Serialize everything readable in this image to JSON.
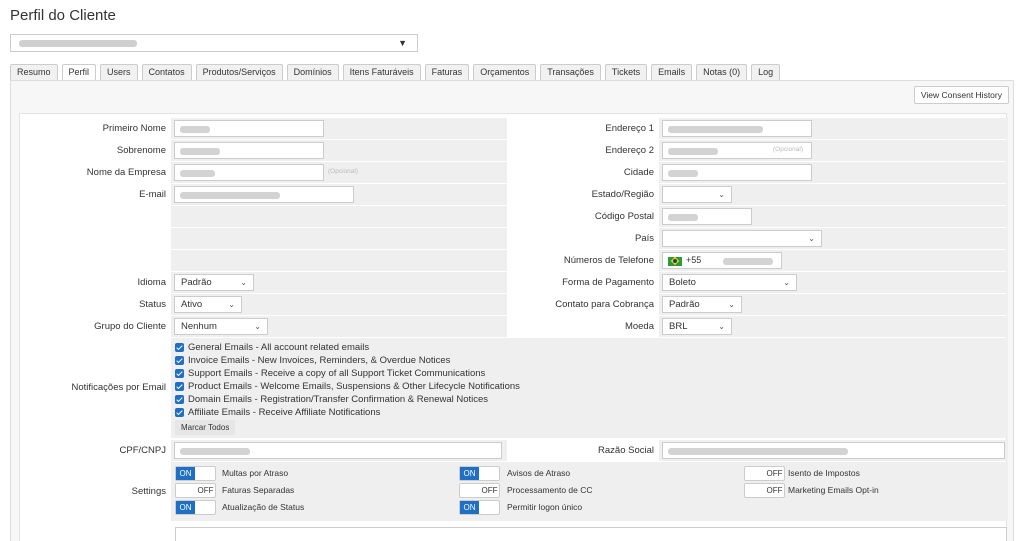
{
  "page": {
    "title": "Perfil do Cliente"
  },
  "tabs": [
    "Resumo",
    "Perfil",
    "Users",
    "Contatos",
    "Produtos/Serviços",
    "Domínios",
    "Itens Faturáveis",
    "Faturas",
    "Orçamentos",
    "Transações",
    "Tickets",
    "Emails",
    "Notas (0)",
    "Log"
  ],
  "active_tab": "Perfil",
  "consent_button": "View Consent History",
  "labels": {
    "first_name": "Primeiro Nome",
    "last_name": "Sobrenome",
    "company": "Nome da Empresa",
    "email": "E-mail",
    "address1": "Endereço 1",
    "address2": "Endereço 2",
    "city": "Cidade",
    "state": "Estado/Região",
    "postcode": "Código Postal",
    "country": "País",
    "phone": "Números de Telefone",
    "language": "Idioma",
    "status": "Status",
    "group": "Grupo do Cliente",
    "payment": "Forma de Pagamento",
    "billing_contact": "Contato para Cobrança",
    "currency": "Moeda",
    "email_notifications": "Notificações por Email",
    "cpf": "CPF/CNPJ",
    "company_name": "Razão Social",
    "settings": "Settings"
  },
  "optional_text": "(Opcional)",
  "values": {
    "phone_code": "+55",
    "language": "Padrão",
    "status": "Ativo",
    "group": "Nenhum",
    "payment": "Boleto",
    "billing_contact": "Padrão",
    "currency": "BRL"
  },
  "notifications": [
    "General Emails - All account related emails",
    "Invoice Emails - New Invoices, Reminders, & Overdue Notices",
    "Support Emails - Receive a copy of all Support Ticket Communications",
    "Product Emails - Welcome Emails, Suspensions & Other Lifecycle Notifications",
    "Domain Emails - Registration/Transfer Confirmation & Renewal Notices",
    "Affiliate Emails - Receive Affiliate Notifications"
  ],
  "mark_all": "Marcar Todos",
  "settings": [
    {
      "label": "Multas por Atraso",
      "state": "ON"
    },
    {
      "label": "Faturas Separadas",
      "state": "OFF"
    },
    {
      "label": "Atualização de Status",
      "state": "ON"
    },
    {
      "label": "Avisos de Atraso",
      "state": "ON"
    },
    {
      "label": "Processamento de CC",
      "state": "OFF"
    },
    {
      "label": "Permitir logon único",
      "state": "ON"
    },
    {
      "label": "Isento de Impostos",
      "state": "OFF"
    },
    {
      "label": "Marketing Emails Opt-in",
      "state": "OFF"
    }
  ],
  "toggle_text": {
    "on": "ON",
    "off": "OFF"
  },
  "colors": {
    "accent": "#1f6fc5",
    "label_bg": "#ffffff",
    "field_bg": "#efefef"
  }
}
